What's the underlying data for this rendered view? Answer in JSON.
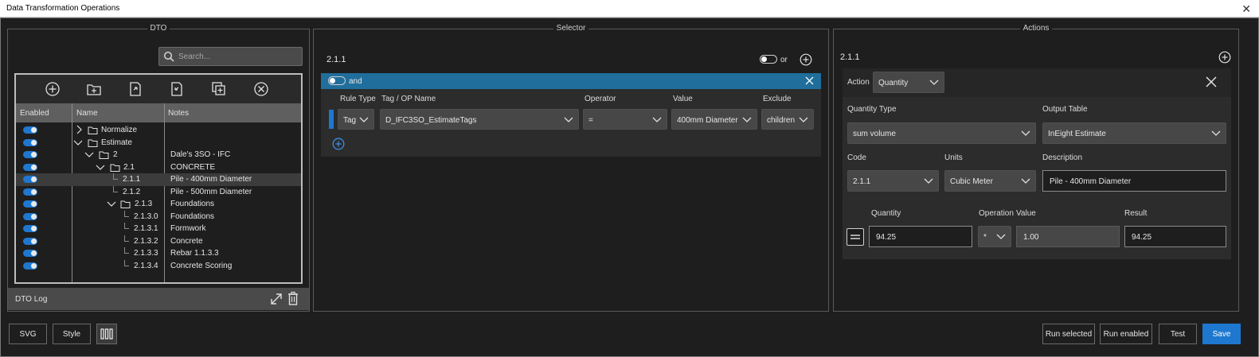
{
  "window": {
    "title": "Data Transformation Operations",
    "close_glyph": "✕"
  },
  "dto_panel": {
    "title": "DTO",
    "search_placeholder": "Search...",
    "columns": {
      "enabled": "Enabled",
      "name": "Name",
      "notes": "Notes"
    },
    "rows": [
      {
        "name": "Normalize",
        "notes": ""
      },
      {
        "name": "Estimate",
        "notes": ""
      },
      {
        "name": "2",
        "notes": "Dale's 3SO - IFC"
      },
      {
        "name": "2.1",
        "notes": "CONCRETE"
      },
      {
        "name": "2.1.1",
        "notes": "Pile - 400mm Diameter"
      },
      {
        "name": "2.1.2",
        "notes": "Pile - 500mm Diameter"
      },
      {
        "name": "2.1.3",
        "notes": "Foundations"
      },
      {
        "name": "2.1.3.0",
        "notes": "Foundations"
      },
      {
        "name": "2.1.3.1",
        "notes": "Formwork"
      },
      {
        "name": "2.1.3.2",
        "notes": "Concrete"
      },
      {
        "name": "2.1.3.3",
        "notes": "Rebar 1.1.3.3"
      },
      {
        "name": "2.1.3.4",
        "notes": "Concrete Scoring"
      }
    ],
    "log_label": "DTO Log"
  },
  "selector_panel": {
    "title": "Selector",
    "current": "2.1.1",
    "or_label": "or",
    "and_label": "and",
    "columns": {
      "rule_type": "Rule Type",
      "tag": "Tag / OP Name",
      "operator": "Operator",
      "value": "Value",
      "exclude": "Exclude"
    },
    "rule": {
      "rule_type": "Tag",
      "tag": "D_IFC3SO_EstimateTags",
      "operator": "=",
      "value": "400mm Diameter",
      "exclude": "children"
    }
  },
  "actions_panel": {
    "title": "Actions",
    "current": "2.1.1",
    "action_label": "Action",
    "action_value": "Quantity",
    "quantity_type_label": "Quantity Type",
    "quantity_type_value": "sum volume",
    "output_table_label": "Output Table",
    "output_table_value": "InEight Estimate",
    "code_label": "Code",
    "code_value": "2.1.1",
    "units_label": "Units",
    "units_value": "Cubic Meter",
    "description_label": "Description",
    "description_value": "Pile - 400mm Diameter",
    "quantity_label": "Quantity",
    "quantity_value": "94.25",
    "operation_label": "Operation",
    "operation_value": "*",
    "value_label": "Value",
    "value_value": "1.00",
    "result_label": "Result",
    "result_value": "94.25"
  },
  "footer": {
    "svg": "SVG",
    "style": "Style",
    "run_selected": "Run selected",
    "run_enabled": "Run enabled",
    "test": "Test",
    "save": "Save"
  },
  "colors": {
    "accent": "#1e78d0",
    "and_bar": "#1f6e9c",
    "background": "#1e1e1e"
  }
}
